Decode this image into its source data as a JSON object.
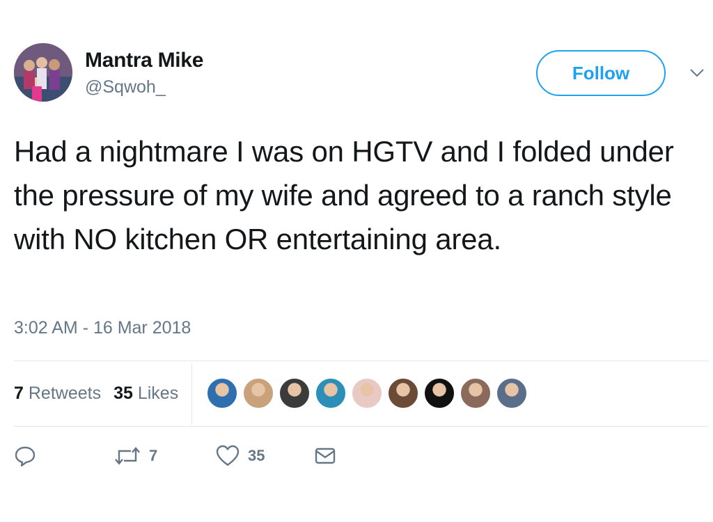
{
  "user": {
    "display_name": "Mantra Mike",
    "handle": "@Sqwoh_"
  },
  "follow_label": "Follow",
  "tweet": {
    "text": "Had a nightmare I was on HGTV and I folded under the pressure of my wife and agreed to a ranch style with NO kitchen OR entertaining area.",
    "timestamp": "3:02 AM - 16 Mar 2018"
  },
  "stats": {
    "retweets_count": "7",
    "retweets_label": "Retweets",
    "likes_count": "35",
    "likes_label": "Likes"
  },
  "likers": [
    {
      "icon": "liker-avatar-1",
      "color": "#2f6fb0"
    },
    {
      "icon": "liker-avatar-2",
      "color": "#c9a27c"
    },
    {
      "icon": "liker-avatar-3",
      "color": "#3b3b3b"
    },
    {
      "icon": "liker-avatar-4",
      "color": "#2b8fb8"
    },
    {
      "icon": "liker-avatar-5",
      "color": "#e9c9c4"
    },
    {
      "icon": "liker-avatar-6",
      "color": "#6b4a36"
    },
    {
      "icon": "liker-avatar-7",
      "color": "#111111"
    },
    {
      "icon": "liker-avatar-8",
      "color": "#8a6a5a"
    },
    {
      "icon": "liker-avatar-9",
      "color": "#5a6e8a"
    }
  ],
  "actions": {
    "reply_icon": "reply-icon",
    "retweet_icon": "retweet-icon",
    "retweet_count": "7",
    "like_icon": "heart-icon",
    "like_count": "35",
    "dm_icon": "envelope-icon"
  },
  "colors": {
    "accent": "#1da1f2",
    "text": "#14171a",
    "secondary": "#657786",
    "divider": "#e1e8ed"
  }
}
